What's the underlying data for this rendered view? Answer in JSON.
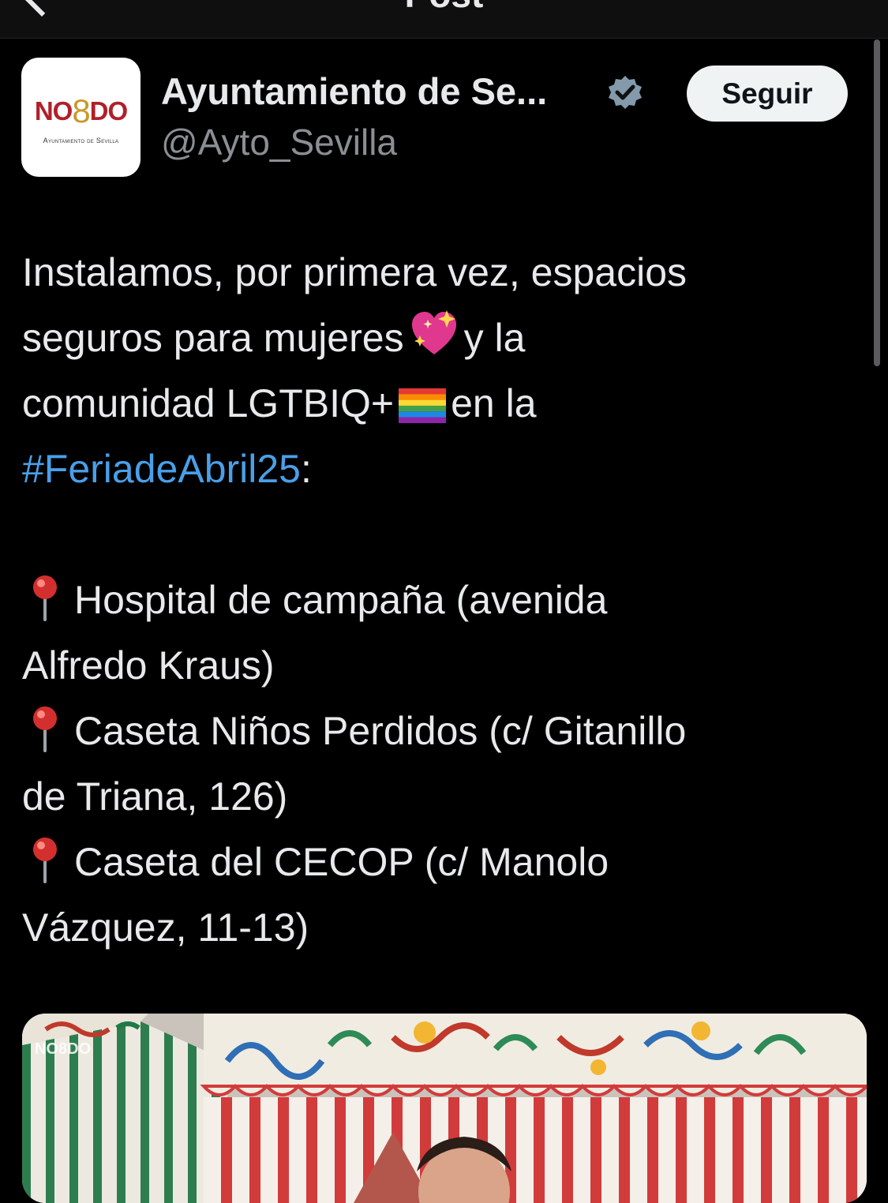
{
  "nav": {
    "title": "Post"
  },
  "author": {
    "avatar_logo": "NO8DO",
    "avatar_subtitle": "Ayuntamiento de Sevilla",
    "name": "Ayuntamiento de Se...",
    "verified_icon": "verified-badge-icon",
    "handle": "@Ayto_Sevilla",
    "follow_label": "Seguir"
  },
  "post": {
    "line1": "Instalamos, por primera vez, espacios",
    "line2_a": "seguros para mujeres",
    "line2_emoji": "sparkling-heart-emoji",
    "line2_b": "y la",
    "line3_a": "comunidad LGTBIQ+",
    "line3_emoji": "rainbow-flag-emoji",
    "line3_b": "en la",
    "hashtag": "#FeriadeAbril25",
    "after_hashtag": ":",
    "locations": [
      {
        "icon": "round-pushpin-emoji",
        "line_a": "Hospital de campaña (avenida",
        "line_b": "Alfredo Kraus)"
      },
      {
        "icon": "round-pushpin-emoji",
        "line_a": "Caseta Niños Perdidos (c/ Gitanillo",
        "line_b": "de Triana, 126)"
      },
      {
        "icon": "round-pushpin-emoji",
        "line_a": "Caseta del CECOP (c/ Manolo",
        "line_b": "Vázquez, 11-13)"
      }
    ]
  },
  "media": {
    "watermark": "NO8DO"
  },
  "colors": {
    "background": "#000000",
    "hashtag": "#4a9fe8",
    "handle": "#8b8f94",
    "verified": "#829aab"
  }
}
